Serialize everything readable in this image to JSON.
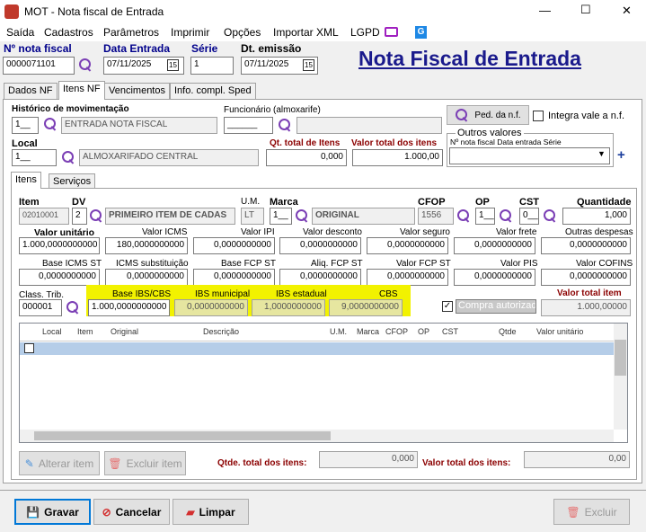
{
  "window": {
    "title": "MOT - Nota fiscal de Entrada",
    "minimize": "—",
    "maximize": "☐",
    "close": "✕"
  },
  "menu": [
    "Saída",
    "Cadastros",
    "Parâmetros",
    "Imprimir",
    "Opções",
    "Importar XML",
    "LGPD"
  ],
  "header": {
    "nf_label": "Nº nota fiscal",
    "nf_value": "0000071101",
    "date_label": "Data Entrada",
    "date_value": "07/11/2025",
    "serie_label": "Série",
    "serie_value": "1",
    "emissao_label": "Dt. emissão",
    "emissao_value": "07/11/2025",
    "big_title": "Nota Fiscal de Entrada",
    "cal": "15"
  },
  "tabs": [
    "Dados NF",
    "Itens NF",
    "Vencimentos",
    "Info. compl. Sped"
  ],
  "top": {
    "hist_label": "Histórico de movimentação",
    "hist_code": "1__",
    "hist_name": "ENTRADA NOTA FISCAL",
    "func_label": "Funcionário (almoxarife)",
    "func_code": "______",
    "ped_btn": "Ped. da n.f.",
    "integra_label": "Integra vale a n.f.",
    "local_label": "Local",
    "local_code": "1__",
    "local_name": "ALMOXARIFADO CENTRAL",
    "qt_total_label": "Qt. total de Itens",
    "qt_total_value": "0,000",
    "valor_total_label": "Valor total dos itens",
    "valor_total_value": "1.000,00",
    "outros_title": "Outros valores",
    "outros_cols": "Nº nota fiscal     Data entrada   Série",
    "plus": "+"
  },
  "subtabs": [
    "Itens",
    "Serviços"
  ],
  "item": {
    "item_label": "Item",
    "item_value": "02010001",
    "dv_label": "DV",
    "dv_value": "2",
    "desc_value": "PRIMEIRO ITEM DE CADAS",
    "um_label": "U.M.",
    "um_value": "LT",
    "marca_label": "Marca",
    "marca_code": "1__",
    "marca_name": "ORIGINAL",
    "cfop_label": "CFOP",
    "cfop_value": "1556",
    "op_label": "OP",
    "op_value": "1__",
    "cst_label": "CST",
    "cst_value": "0__",
    "qtd_label": "Quantidade",
    "qtd_value": "1,000"
  },
  "row1": [
    {
      "label": "Valor unitário",
      "value": "1.000,0000000000"
    },
    {
      "label": "Valor ICMS",
      "value": "180,0000000000"
    },
    {
      "label": "Valor IPI",
      "value": "0,0000000000"
    },
    {
      "label": "Valor desconto",
      "value": "0,0000000000"
    },
    {
      "label": "Valor seguro",
      "value": "0,0000000000"
    },
    {
      "label": "Valor frete",
      "value": "0,0000000000"
    },
    {
      "label": "Outras despesas",
      "value": "0,0000000000"
    }
  ],
  "row2": [
    {
      "label": "Base ICMS ST",
      "value": "0,0000000000"
    },
    {
      "label": "ICMS substituição",
      "value": "0,0000000000"
    },
    {
      "label": "Base FCP ST",
      "value": "0,0000000000"
    },
    {
      "label": "Aliq. FCP ST",
      "value": "0,0000000000"
    },
    {
      "label": "Valor FCP ST",
      "value": "0,0000000000"
    },
    {
      "label": "Valor PIS",
      "value": "0,0000000000"
    },
    {
      "label": "Valor COFINS",
      "value": "0,0000000000"
    }
  ],
  "row3": {
    "class_label": "Class. Trib.",
    "class_value": "000001",
    "ibs_base_label": "Base IBS/CBS",
    "ibs_base_value": "1.000,0000000000",
    "ibs_mun_label": "IBS municipal",
    "ibs_mun_value": "0,0000000000",
    "ibs_est_label": "IBS estadual",
    "ibs_est_value": "1,0000000000",
    "cbs_label": "CBS",
    "cbs_value": "9,0000000000",
    "compra_label": "Compra autorizada",
    "vti_label": "Valor total item",
    "vti_value": "1.000,00000"
  },
  "grid": {
    "headers": [
      "Local",
      "Item",
      "Original",
      "Descrição",
      "U.M.",
      "Marca",
      "CFOP",
      "OP",
      "CST",
      "Qtde",
      "Valor unitário"
    ]
  },
  "bottom": {
    "alterar": "Alterar item",
    "excluir_item": "Excluir item",
    "qtde_label": "Qtde. total dos itens:",
    "qtde_value": "0,000",
    "valor_label": "Valor total dos itens:",
    "valor_value": "0,00"
  },
  "footer": {
    "gravar": "Gravar",
    "cancelar": "Cancelar",
    "limpar": "Limpar",
    "excluir": "Excluir"
  }
}
